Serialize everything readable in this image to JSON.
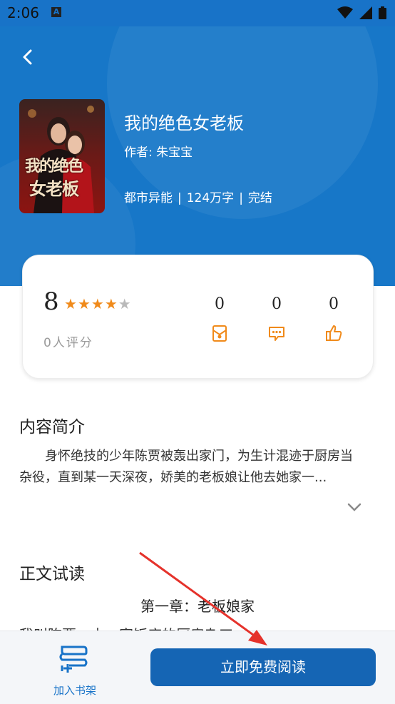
{
  "status_bar": {
    "time": "2:06",
    "notification_badge": "A",
    "icons": [
      "wifi-icon",
      "cellular-icon",
      "battery-icon"
    ]
  },
  "header": {
    "back_icon": "back-arrow-icon",
    "background_color": "#1777c8"
  },
  "book": {
    "title": "我的绝色女老板",
    "author": "作者: 朱宝宝",
    "category": "都市异能",
    "word_count": "124万字",
    "status": "完结",
    "cover_text_line1": "我的绝色",
    "cover_text_line2": "女老板"
  },
  "rating": {
    "score": "8",
    "stars_filled": 4,
    "stars_total": 5,
    "rating_count": "0人评分",
    "stats": [
      {
        "value": "0",
        "icon": "monthly-ticket-icon"
      },
      {
        "value": "0",
        "icon": "comment-icon"
      },
      {
        "value": "0",
        "icon": "thumbs-up-icon"
      }
    ]
  },
  "intro": {
    "heading": "内容简介",
    "text": "身怀绝技的少年陈贾被轰出家门，为生计混迹于厨房当杂役，直到某一天深夜，娇美的老板娘让他去她家一..."
  },
  "trial": {
    "heading": "正文试读",
    "chapter_title": "第一章：老板娘家",
    "peek_text": "我叫陈贾，由一家饭店的厨房杂工"
  },
  "bottom_bar": {
    "shelf_label": "加入书架",
    "read_label": "立即免费阅读"
  },
  "colors": {
    "brand": "#1777c8",
    "button": "#1565b4",
    "star": "#f08a1a",
    "accent_icon": "#f08a1a",
    "annotation_arrow": "#e5322b"
  }
}
